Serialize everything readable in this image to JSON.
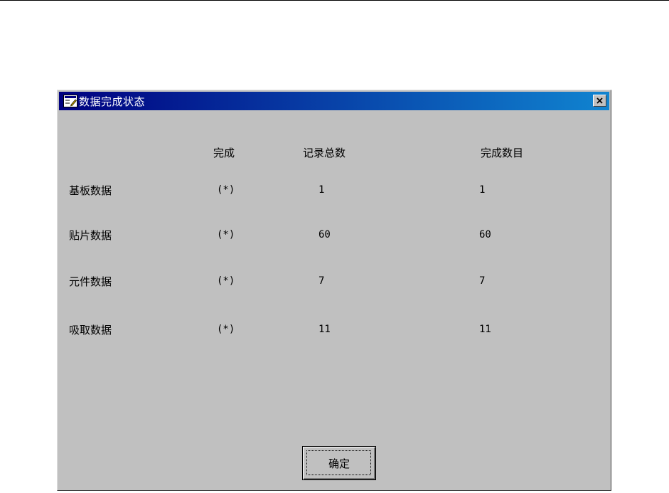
{
  "window": {
    "title": "数据完成状态",
    "close_label": "×"
  },
  "table": {
    "headers": [
      "完成",
      "记录总数",
      "完成数目"
    ],
    "rows": [
      {
        "label": "基板数据",
        "done": "(*)",
        "total": "1",
        "completed": "1"
      },
      {
        "label": "贴片数据",
        "done": "(*)",
        "total": "60",
        "completed": "60"
      },
      {
        "label": "元件数据",
        "done": "(*)",
        "total": "7",
        "completed": "7"
      },
      {
        "label": "吸取数据",
        "done": "(*)",
        "total": "11",
        "completed": "11"
      }
    ]
  },
  "buttons": {
    "ok_label": "确定"
  },
  "colors": {
    "titlebar_start": "#000080",
    "titlebar_end": "#1084d0",
    "window_bg": "#c0c0c0"
  },
  "icons": {
    "app": "dialog-app-icon",
    "close": "close-icon"
  }
}
